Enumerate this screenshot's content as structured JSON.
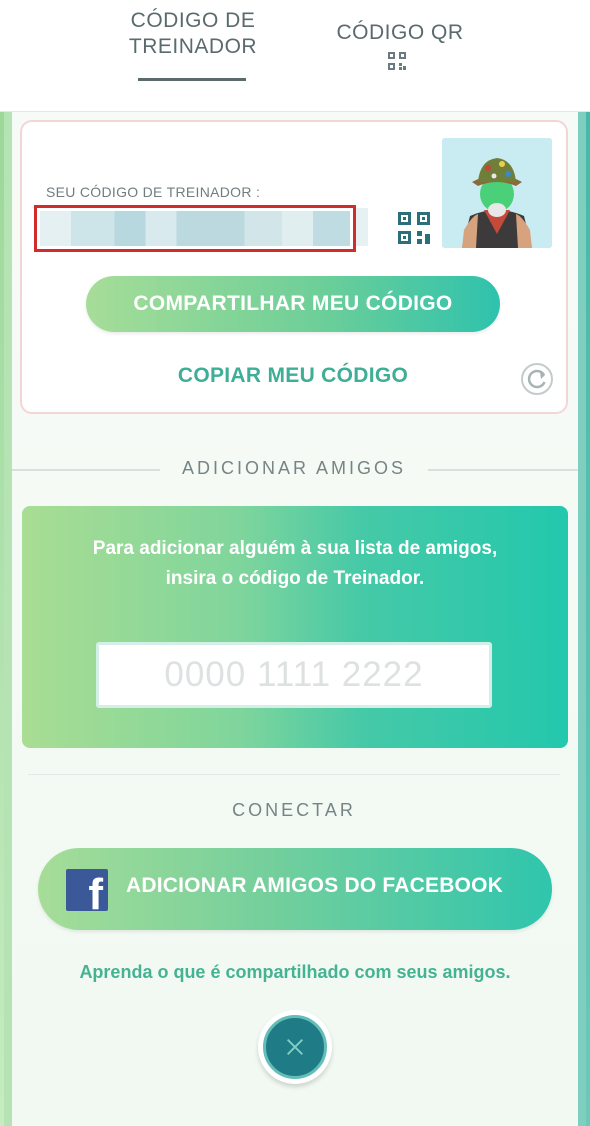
{
  "tabs": [
    {
      "label_line1": "CÓDIGO DE",
      "label_line2": "TREINADOR",
      "selected": true
    },
    {
      "label": "CÓDIGO QR",
      "icon": "qr-code-icon",
      "selected": false
    }
  ],
  "trainer_card": {
    "code_label": "SEU CÓDIGO DE TREINADOR :",
    "share_button": "COMPARTILHAR MEU CÓDIGO",
    "copy_button": "COPIAR MEU CÓDIGO",
    "qr_icon": "qr-code-icon",
    "refresh_icon": "refresh-icon"
  },
  "add_friends": {
    "section_title": "ADICIONAR AMIGOS",
    "instructions": "Para adicionar alguém à sua lista de amigos, insira o código de Treinador.",
    "input_placeholder": "0000 1111 2222"
  },
  "connect": {
    "section_title": "CONECTAR",
    "facebook_button": "ADICIONAR AMIGOS DO FACEBOOK",
    "learn_link": "Aprenda o que é compartilhado com seus amigos."
  },
  "close_icon": "close-icon",
  "colors": {
    "accent": "#3fae96",
    "facebook": "#3b5998",
    "redaction_border": "#d02c2c",
    "close_bg": "#1f7b86"
  }
}
